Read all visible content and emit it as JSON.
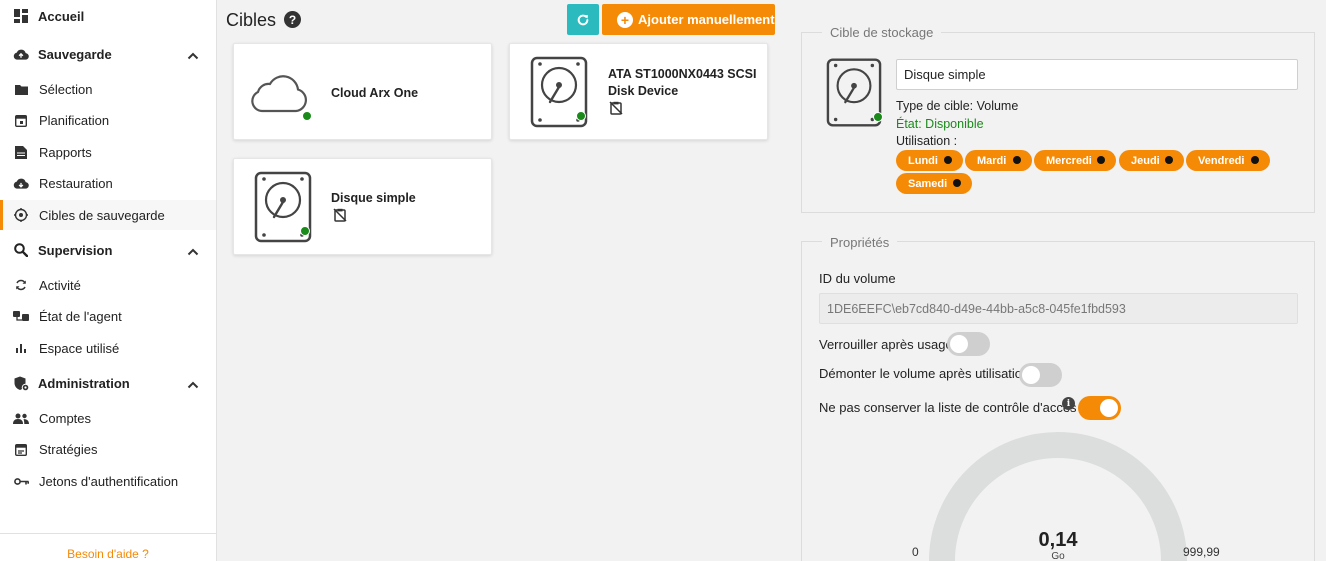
{
  "sidebar": {
    "items": [
      {
        "label": "Accueil",
        "icon": "dashboard-icon",
        "type": "top"
      },
      {
        "label": "Sauvegarde",
        "icon": "cloud-upload-icon",
        "type": "section"
      },
      {
        "label": "Sélection",
        "icon": "folder-icon",
        "type": "sub"
      },
      {
        "label": "Planification",
        "icon": "calendar-icon",
        "type": "sub"
      },
      {
        "label": "Rapports",
        "icon": "report-icon",
        "type": "sub"
      },
      {
        "label": "Restauration",
        "icon": "cloud-download-icon",
        "type": "sub"
      },
      {
        "label": "Cibles de sauvegarde",
        "icon": "target-icon",
        "type": "sub",
        "active": true
      },
      {
        "label": "Supervision",
        "icon": "search-icon",
        "type": "section"
      },
      {
        "label": "Activité",
        "icon": "sync-icon",
        "type": "sub"
      },
      {
        "label": "État de l'agent",
        "icon": "agent-icon",
        "type": "sub"
      },
      {
        "label": "Espace utilisé",
        "icon": "bar-chart-icon",
        "type": "sub"
      },
      {
        "label": "Administration",
        "icon": "admin-shield-icon",
        "type": "section"
      },
      {
        "label": "Comptes",
        "icon": "users-icon",
        "type": "sub"
      },
      {
        "label": "Stratégies",
        "icon": "policy-icon",
        "type": "sub"
      },
      {
        "label": "Jetons d'authentification",
        "icon": "key-icon",
        "type": "sub"
      }
    ],
    "help_link": "Besoin d'aide ?"
  },
  "header": {
    "title": "Cibles",
    "help_icon": "?",
    "add_button": "Ajouter manuellement"
  },
  "cards": [
    {
      "name": "Cloud Arx One",
      "icon": "cloud-icon",
      "status": "available"
    },
    {
      "name": "ATA ST1000NX0443 SCSI Disk Device",
      "icon": "hard-disk-icon",
      "status": "available"
    },
    {
      "name": "Disque simple",
      "icon": "hard-disk-icon",
      "status": "available"
    }
  ],
  "storage_target": {
    "legend": "Cible de stockage",
    "name_value": "Disque simple",
    "type_line": "Type de cible: Volume",
    "state_line": "État: Disponible",
    "usage_label": "Utilisation :",
    "days": [
      "Lundi",
      "Mardi",
      "Mercredi",
      "Jeudi",
      "Vendredi",
      "Samedi"
    ]
  },
  "properties": {
    "legend": "Propriétés",
    "volume_id_label": "ID du volume",
    "volume_id_value": "1DE6EEFC\\eb7cd840-d49e-44bb-a5c8-045fe1fbd593",
    "lock_label": "Verrouiller après usage",
    "lock_on": false,
    "unmount_label": "Démonter le volume après utilisation",
    "unmount_on": false,
    "acl_label": "Ne pas conserver la liste de contrôle d'accès",
    "acl_on": true,
    "info_icon": "i"
  },
  "gauge": {
    "value": "0,14",
    "unit": "Go",
    "min": "0",
    "max": "999,99",
    "fraction": 0.00014
  },
  "colors": {
    "accent": "#f58a07",
    "teal": "#2bbbbf",
    "status_ok": "#1a8a1a"
  }
}
